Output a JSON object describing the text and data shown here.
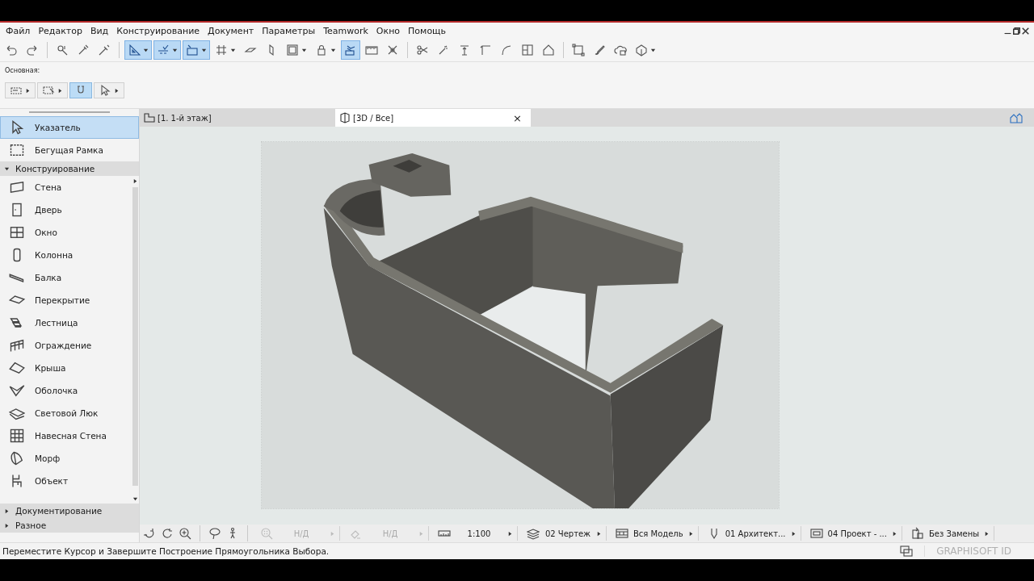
{
  "menu": [
    "Файл",
    "Редактор",
    "Вид",
    "Конструирование",
    "Документ",
    "Параметры",
    "Teamwork",
    "Окно",
    "Помощь"
  ],
  "toolbar": [
    [
      {
        "kind": "undo",
        "selected": false,
        "menu": false
      },
      {
        "kind": "redo",
        "selected": false,
        "menu": false
      }
    ],
    [
      {
        "kind": "pick",
        "selected": false,
        "menu": false
      },
      {
        "kind": "eyedropper",
        "selected": false,
        "menu": false
      },
      {
        "kind": "syringe",
        "selected": false,
        "menu": false
      }
    ],
    [
      {
        "kind": "guide",
        "selected": true,
        "menu": true
      },
      {
        "kind": "snap",
        "selected": true,
        "menu": true
      },
      {
        "kind": "coord",
        "selected": true,
        "menu": true
      },
      {
        "kind": "grid",
        "selected": false,
        "menu": true
      },
      {
        "kind": "plane",
        "selected": false,
        "menu": false
      },
      {
        "kind": "sheet",
        "selected": false,
        "menu": false
      },
      {
        "kind": "frame",
        "selected": false,
        "menu": true
      },
      {
        "kind": "lock",
        "selected": false,
        "menu": true
      },
      {
        "kind": "trace",
        "selected": true,
        "menu": false
      },
      {
        "kind": "ruler",
        "selected": false,
        "menu": false
      },
      {
        "kind": "cross",
        "selected": false,
        "menu": false
      }
    ],
    [
      {
        "kind": "scissors",
        "selected": false,
        "menu": false
      },
      {
        "kind": "magic",
        "selected": false,
        "menu": false
      },
      {
        "kind": "elevate",
        "selected": false,
        "menu": false
      },
      {
        "kind": "corner",
        "selected": false,
        "menu": false
      },
      {
        "kind": "arc",
        "selected": false,
        "menu": false
      },
      {
        "kind": "split",
        "selected": false,
        "menu": false
      },
      {
        "kind": "house",
        "selected": false,
        "menu": false
      }
    ],
    [
      {
        "kind": "group",
        "selected": false,
        "menu": false
      },
      {
        "kind": "brush",
        "selected": false,
        "menu": false
      },
      {
        "kind": "cloud",
        "selected": false,
        "menu": false
      },
      {
        "kind": "morph",
        "selected": false,
        "menu": true
      }
    ]
  ],
  "quick_toolbar": {
    "label": "Основная:",
    "buttons": [
      {
        "kind": "wallmarquee",
        "selected": false
      },
      {
        "kind": "marqueepointer",
        "selected": false
      },
      {
        "kind": "magnet",
        "selected": true
      },
      {
        "kind": "pointer",
        "selected": false
      }
    ]
  },
  "toolbox": {
    "pinned": [
      {
        "label": "Указатель",
        "kind": "pointer",
        "selected": true
      },
      {
        "label": "Бегущая Рамка",
        "kind": "marquee",
        "selected": false
      }
    ],
    "sections": [
      {
        "label": "Конструирование",
        "expanded": true,
        "items": [
          {
            "label": "Стена",
            "kind": "wall"
          },
          {
            "label": "Дверь",
            "kind": "door"
          },
          {
            "label": "Окно",
            "kind": "window"
          },
          {
            "label": "Колонна",
            "kind": "column"
          },
          {
            "label": "Балка",
            "kind": "beam"
          },
          {
            "label": "Перекрытие",
            "kind": "slab"
          },
          {
            "label": "Лестница",
            "kind": "stair"
          },
          {
            "label": "Ограждение",
            "kind": "railing"
          },
          {
            "label": "Крыша",
            "kind": "roof"
          },
          {
            "label": "Оболочка",
            "kind": "shell"
          },
          {
            "label": "Световой Люк",
            "kind": "skylight"
          },
          {
            "label": "Навесная Стена",
            "kind": "curtain"
          },
          {
            "label": "Морф",
            "kind": "morph3d"
          },
          {
            "label": "Объект",
            "kind": "object"
          }
        ]
      },
      {
        "label": "Документирование",
        "expanded": false
      },
      {
        "label": "Разное",
        "expanded": false
      }
    ]
  },
  "tabs": [
    {
      "label": "[1. 1-й этаж]",
      "kind": "floor",
      "selected": false
    },
    {
      "label": "[3D / Все]",
      "kind": "view3d",
      "selected": true,
      "close": "×"
    }
  ],
  "navigator": [
    {
      "kind": "zoomfit",
      "value": "Н/Д",
      "disabled": true
    },
    {
      "kind": "eraser",
      "value": "Н/Д",
      "disabled": true
    },
    {
      "kind": "scale",
      "value": "1:100",
      "disabled": false
    },
    {
      "kind": "layers",
      "value": "02 Чертеж",
      "disabled": false
    },
    {
      "kind": "filter",
      "value": "Вся Модель",
      "disabled": false
    },
    {
      "kind": "pen",
      "value": "01 Архитект...",
      "disabled": false
    },
    {
      "kind": "monitor",
      "value": "04 Проект - ...",
      "disabled": false
    },
    {
      "kind": "override",
      "value": "Без Замены",
      "disabled": false
    }
  ],
  "status_bar": {
    "message": "Переместите Курсор и Завершите Построение Прямоугольника Выбора.",
    "brand": "GRAPHISOFT ID"
  }
}
